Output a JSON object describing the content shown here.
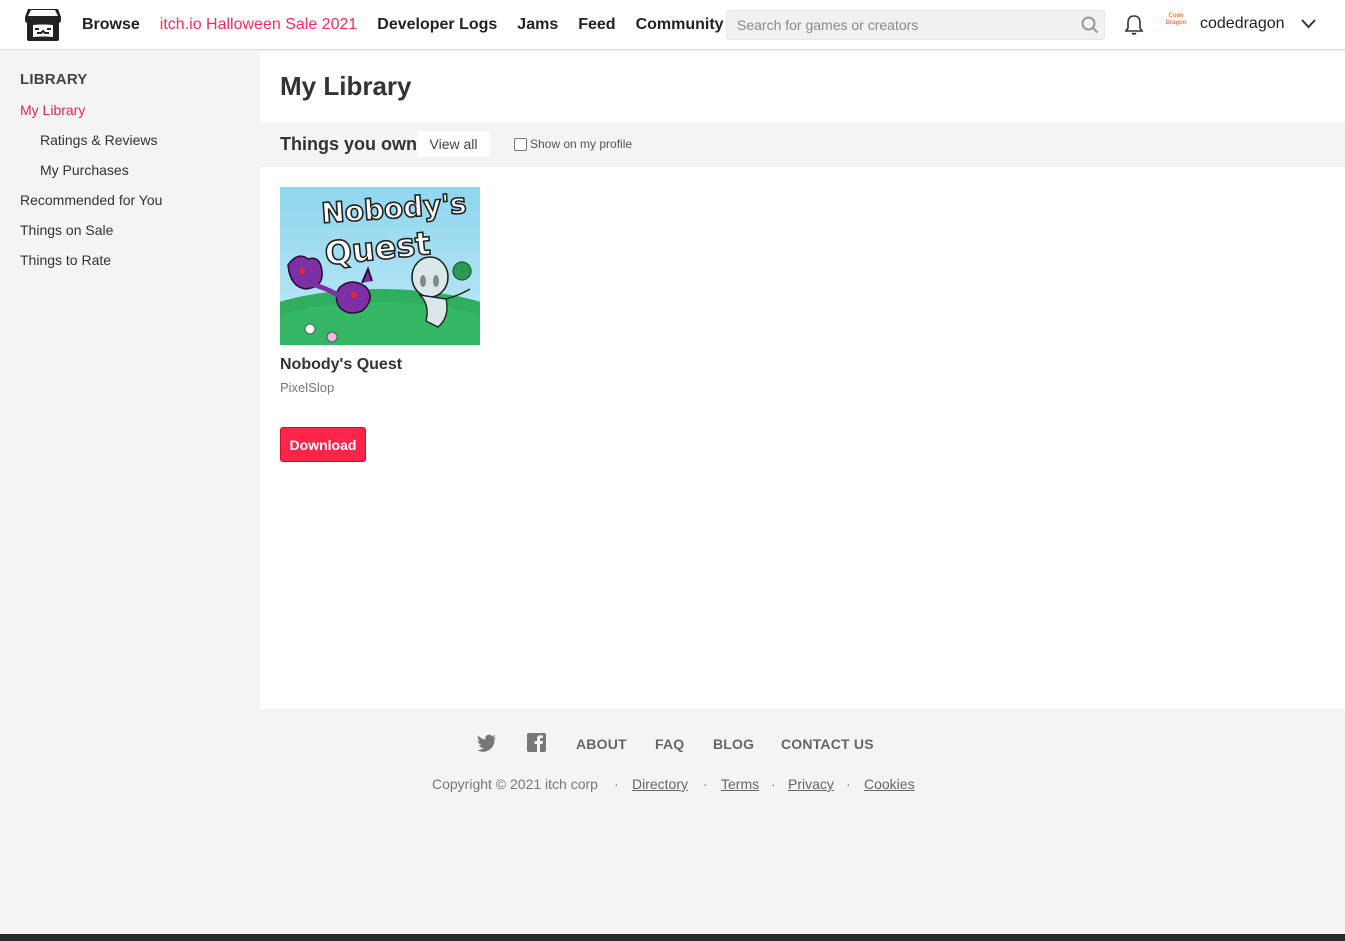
{
  "header": {
    "nav": [
      {
        "label": "Browse"
      },
      {
        "label": "itch.io Halloween Sale 2021"
      },
      {
        "label": "Developer Logs"
      },
      {
        "label": "Jams"
      },
      {
        "label": "Feed"
      },
      {
        "label": "Community"
      }
    ],
    "search_placeholder": "Search for games or creators",
    "username": "codedragon",
    "avatar_text": "Code Dragon"
  },
  "sidebar": {
    "title": "LIBRARY",
    "items": [
      {
        "label": "My Library",
        "active": true
      },
      {
        "label": "Ratings & Reviews"
      },
      {
        "label": "My Purchases"
      },
      {
        "label": "Recommended for You"
      },
      {
        "label": "Things on Sale"
      },
      {
        "label": "Things to Rate"
      }
    ]
  },
  "main": {
    "title": "My Library",
    "section_title": "Things you own",
    "view_all": "View all",
    "show_on_profile": "Show on my profile",
    "game": {
      "cover_text": "Nobody's Quest",
      "title": "Nobody's Quest",
      "author": "PixelSlop",
      "download_label": "Download"
    }
  },
  "footer": {
    "links": [
      "ABOUT",
      "FAQ",
      "BLOG",
      "CONTACT US"
    ],
    "copyright": "Copyright © 2021 itch corp",
    "sep": "·",
    "legal": [
      "Directory",
      "Terms",
      "Privacy",
      "Cookies"
    ]
  },
  "colors": {
    "accent": "#fa2d56",
    "sidebar_active": "#da2c4d",
    "download_bg": "#ff2449"
  }
}
